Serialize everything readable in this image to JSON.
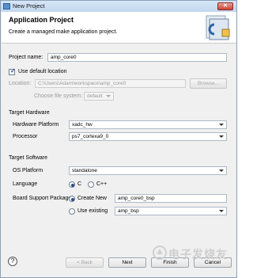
{
  "window": {
    "title": "New Project"
  },
  "header": {
    "title": "Application Project",
    "description": "Create a managed make application project."
  },
  "project": {
    "name_label": "Project name:",
    "name_value": "amp_core0",
    "use_default_label": "Use default location",
    "location_label": "Location:",
    "location_value": "C:\\Users\\Adam\\workspace\\amp_core0",
    "browse_label": "Browse...",
    "filesystem_label": "Choose file system:",
    "filesystem_value": "default"
  },
  "target_hardware": {
    "section_label": "Target Hardware",
    "platform_label": "Hardware Platform",
    "platform_value": "xadc_hw",
    "processor_label": "Processor",
    "processor_value": "ps7_cortexa9_0"
  },
  "target_software": {
    "section_label": "Target Software",
    "os_label": "OS Platform",
    "os_value": "standalone",
    "language_label": "Language",
    "lang_c": "C",
    "lang_cpp": "C++",
    "bsp_label": "Board Support Package",
    "create_new_label": "Create New",
    "create_new_value": "amp_core0_bsp",
    "use_existing_label": "Use existing",
    "use_existing_value": "amp_bsp"
  },
  "footer": {
    "help": "?",
    "back_label": "< Back",
    "next_label": "Next",
    "finish_label": "Finish",
    "cancel_label": "Cancel"
  },
  "watermark": {
    "text": "电子发烧友",
    "sub": "www.elecfans.com"
  }
}
